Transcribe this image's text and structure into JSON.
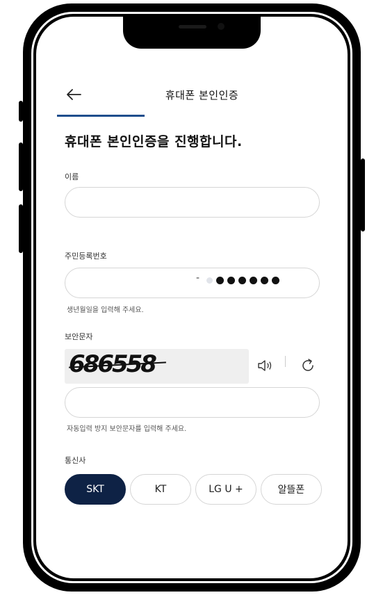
{
  "header": {
    "title": "휴대폰 본인인증"
  },
  "main_title": "휴대폰 본인인증을 진행합니다.",
  "name_field": {
    "label": "이름",
    "value": ""
  },
  "rrn_field": {
    "label": "주민등록번호",
    "value": "",
    "separator": "-",
    "hint": "생년월일을 입력해 주세요."
  },
  "captcha": {
    "label": "보안문자",
    "text": "686558",
    "input_value": "",
    "hint": "자동입력 방지 보안문자를 입력해 주세요."
  },
  "carrier": {
    "label": "통신사",
    "options": [
      {
        "label": "SKT",
        "selected": true
      },
      {
        "label": "KT",
        "selected": false
      },
      {
        "label": "LG U +",
        "selected": false
      },
      {
        "label": "알뜰폰",
        "selected": false
      }
    ]
  },
  "colors": {
    "accent": "#1f4e8c",
    "selected_bg": "#0e2245"
  },
  "icons": [
    "back-arrow-icon",
    "speaker-icon",
    "refresh-icon"
  ]
}
